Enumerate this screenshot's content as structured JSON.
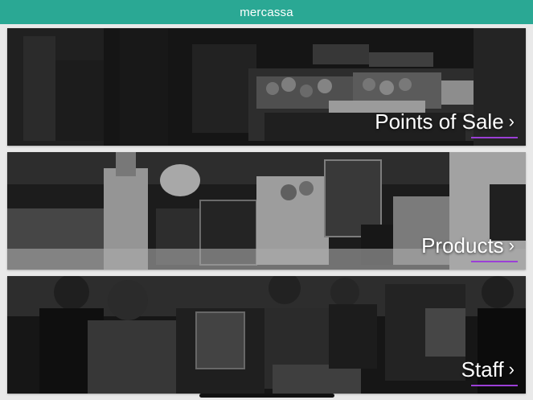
{
  "app": {
    "title": "mercassa"
  },
  "cards": [
    {
      "label": "Points of Sale",
      "chevron": "›",
      "image": "market-produce-photo"
    },
    {
      "label": "Products",
      "chevron": "›",
      "image": "jars-and-goods-photo"
    },
    {
      "label": "Staff",
      "chevron": "›",
      "image": "cashier-counter-photo"
    }
  ],
  "colors": {
    "header": "#2aa894",
    "accent_underline": "#9b3fd6",
    "background": "#e9e9e9"
  }
}
